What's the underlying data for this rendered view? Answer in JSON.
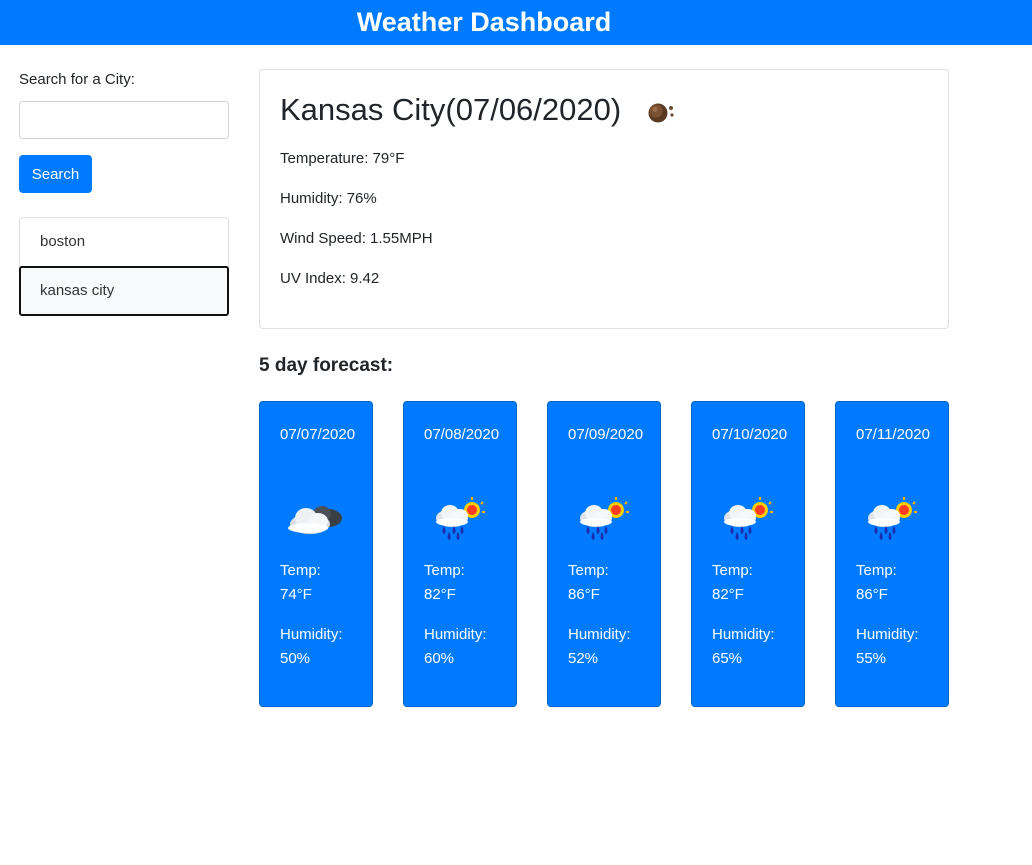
{
  "header": {
    "title": "Weather Dashboard"
  },
  "sidebar": {
    "search_label": "Search for a City:",
    "search_value": "",
    "search_button": "Search",
    "history": [
      "boston",
      "kansas city"
    ],
    "active_history_index": 1
  },
  "current": {
    "title": "Kansas City(07/06/2020)",
    "icon": "smoke-icon",
    "temperature": "Temperature: 79°F",
    "humidity": "Humidity: 76%",
    "wind": "Wind Speed: 1.55MPH",
    "uv": "UV Index: 9.42"
  },
  "forecast": {
    "heading": "5 day forecast:",
    "days": [
      {
        "date": "07/07/2020",
        "icon": "cloudy-night-icon",
        "temp_label": "Temp:",
        "temp": "74°F",
        "hum_label": "Humidity:",
        "hum": "50%"
      },
      {
        "date": "07/08/2020",
        "icon": "rain-sun-icon",
        "temp_label": "Temp:",
        "temp": "82°F",
        "hum_label": "Humidity:",
        "hum": "60%"
      },
      {
        "date": "07/09/2020",
        "icon": "rain-sun-icon",
        "temp_label": "Temp:",
        "temp": "86°F",
        "hum_label": "Humidity:",
        "hum": "52%"
      },
      {
        "date": "07/10/2020",
        "icon": "rain-sun-icon",
        "temp_label": "Temp:",
        "temp": "82°F",
        "hum_label": "Humidity:",
        "hum": "65%"
      },
      {
        "date": "07/11/2020",
        "icon": "rain-sun-icon",
        "temp_label": "Temp:",
        "temp": "86°F",
        "hum_label": "Humidity:",
        "hum": "55%"
      }
    ]
  },
  "colors": {
    "primary": "#007bff",
    "text": "#212529",
    "border": "#dee2e6"
  }
}
